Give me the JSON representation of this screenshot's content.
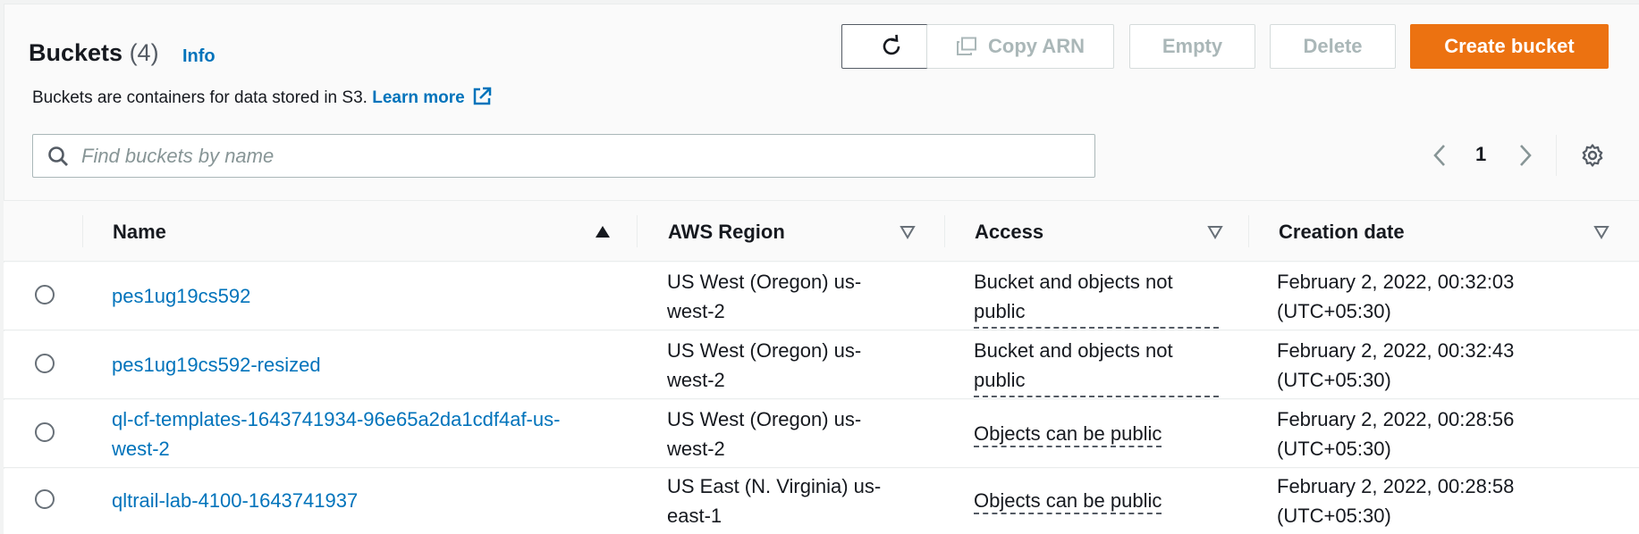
{
  "header": {
    "title": "Buckets",
    "count": "(4)",
    "info_label": "Info",
    "description": "Buckets are containers for data stored in S3.",
    "learn_more": "Learn more"
  },
  "toolbar": {
    "copy_arn_label": "Copy ARN",
    "empty_label": "Empty",
    "delete_label": "Delete",
    "create_label": "Create bucket"
  },
  "search": {
    "placeholder": "Find buckets by name",
    "value": ""
  },
  "pagination": {
    "current_page": "1"
  },
  "table": {
    "columns": [
      "Name",
      "AWS Region",
      "Access",
      "Creation date"
    ],
    "rows": [
      {
        "name": "pes1ug19cs592",
        "region_line1": "US West (Oregon) us-",
        "region_line2": "west-2",
        "access_line1": "Bucket and objects not",
        "access_line2": "public",
        "date_line1": "February 2, 2022, 00:32:03",
        "date_line2": "(UTC+05:30)"
      },
      {
        "name": "pes1ug19cs592-resized",
        "region_line1": "US West (Oregon) us-",
        "region_line2": "west-2",
        "access_line1": "Bucket and objects not",
        "access_line2": "public",
        "date_line1": "February 2, 2022, 00:32:43",
        "date_line2": "(UTC+05:30)"
      },
      {
        "name_line1": "ql-cf-templates-1643741934-96e65a2da1cdf4af-us-",
        "name_line2": "west-2",
        "region_line1": "US West (Oregon) us-",
        "region_line2": "west-2",
        "access_line1": "Objects can be public",
        "date_line1": "February 2, 2022, 00:28:56",
        "date_line2": "(UTC+05:30)"
      },
      {
        "name": "qltrail-lab-4100-1643741937",
        "region_line1": "US East (N. Virginia) us-",
        "region_line2": "east-1",
        "access_line1": "Objects can be public",
        "date_line1": "February 2, 2022, 00:28:58",
        "date_line2": "(UTC+05:30)"
      }
    ]
  },
  "colors": {
    "link": "#0073bb",
    "primary_button": "#ec7211",
    "disabled_text": "#aab7b8",
    "border": "#eaeded"
  },
  "icons": {
    "refresh": "refresh-icon",
    "copy": "copy-icon",
    "external_link": "external-link-icon",
    "search": "search-icon",
    "prev": "chevron-left-icon",
    "next": "chevron-right-icon",
    "settings": "gear-icon",
    "sort_asc": "sort-ascending-icon",
    "sort": "sort-descending-icon"
  }
}
